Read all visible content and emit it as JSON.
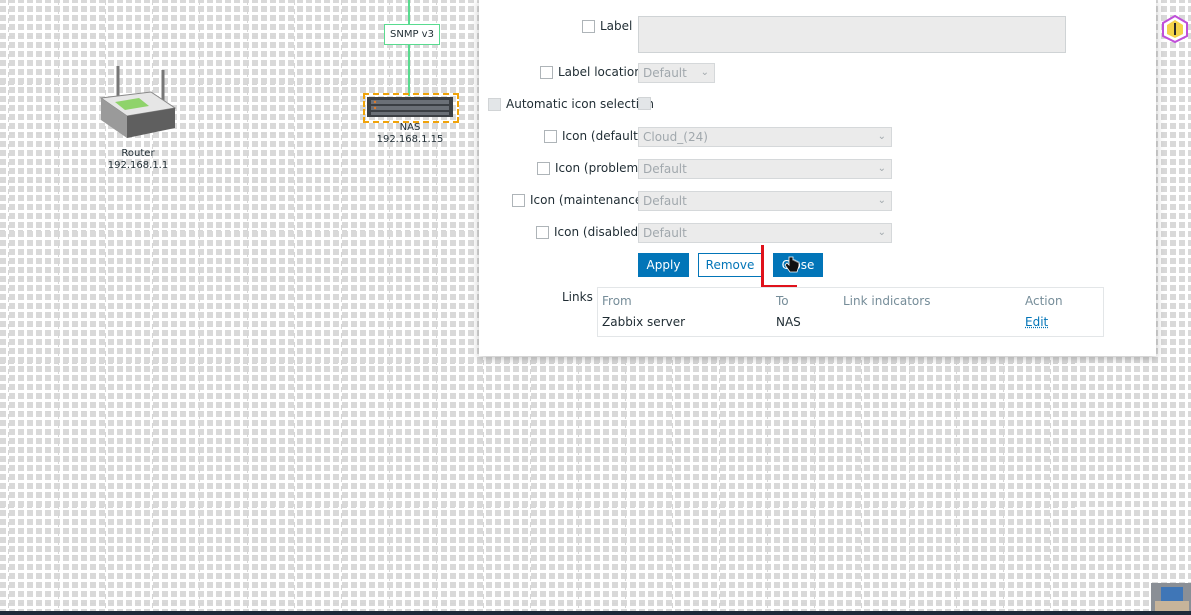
{
  "map": {
    "elements": [
      {
        "name": "Router",
        "address": "192.168.1.1"
      },
      {
        "name": "NAS",
        "address": "192.168.1.15"
      }
    ],
    "link_label": "SNMP v3"
  },
  "form": {
    "label_field": {
      "label": "Label",
      "value": ""
    },
    "label_location": {
      "label": "Label location",
      "value": "Default"
    },
    "automatic_icon": {
      "label": "Automatic icon selection"
    },
    "icon_default": {
      "label": "Icon (default)",
      "value": "Cloud_(24)"
    },
    "icon_problem": {
      "label": "Icon (problem)",
      "value": "Default"
    },
    "icon_maintenance": {
      "label": "Icon (maintenance)",
      "value": "Default"
    },
    "icon_disabled": {
      "label": "Icon (disabled)",
      "value": "Default"
    },
    "buttons": {
      "apply": "Apply",
      "remove": "Remove",
      "close": "Close"
    },
    "links": {
      "label": "Links",
      "columns": [
        "From",
        "To",
        "Link indicators",
        "Action"
      ],
      "rows": [
        {
          "from": "Zabbix server",
          "to": "NAS",
          "indicators": "",
          "action": "Edit"
        }
      ]
    }
  },
  "colors": {
    "primary": "#0275b8",
    "link_line": "#59db8f",
    "selection": "#f0a30a",
    "annotation": "#e0121b"
  }
}
